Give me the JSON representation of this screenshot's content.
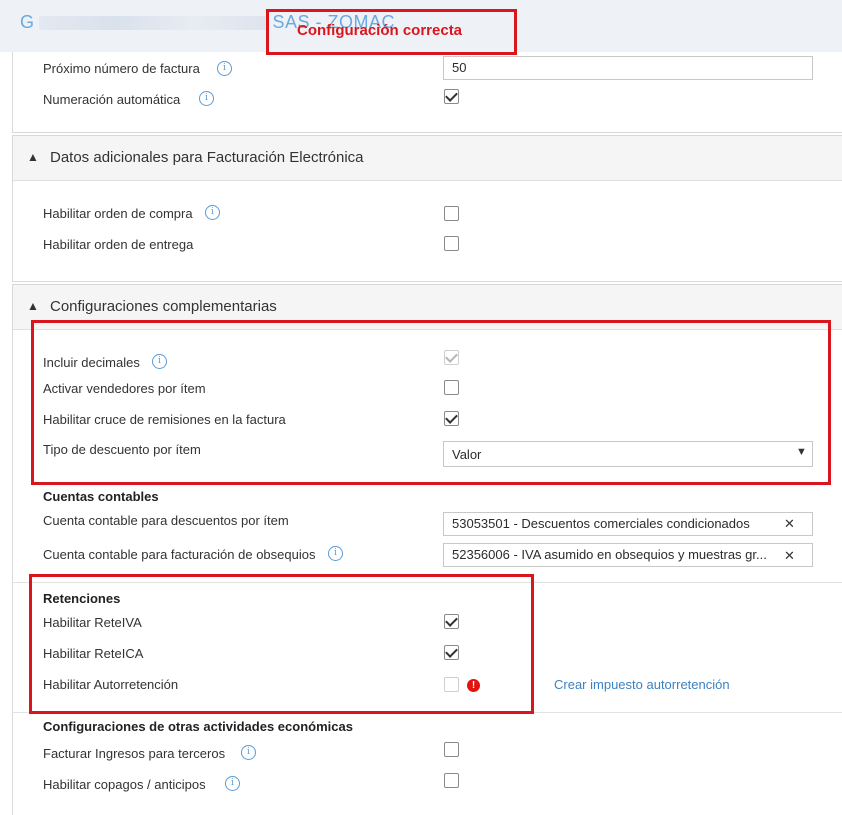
{
  "header": {
    "company_left": "G",
    "company_right": "SAS - ZOMAC"
  },
  "banner": {
    "text": "Configuración correcta"
  },
  "numbering": {
    "next_invoice_label": "Próximo número de factura",
    "next_invoice_value": "50",
    "auto_numbering_label": "Numeración automática",
    "auto_numbering_checked": true
  },
  "e_invoice": {
    "title": "Datos adicionales para Facturación Electrónica",
    "purchase_order_label": "Habilitar orden de compra",
    "delivery_order_label": "Habilitar orden de entrega"
  },
  "complementary": {
    "title": "Configuraciones complementarias",
    "decimals_label": "Incluir decimales",
    "sellers_label": "Activar vendedores por ítem",
    "remissions_label": "Habilitar cruce de remisiones en la factura",
    "discount_type_label": "Tipo de descuento por ítem",
    "discount_type_value": "Valor"
  },
  "accounts": {
    "title": "Cuentas contables",
    "discount_account_label": "Cuenta contable para descuentos por ítem",
    "discount_account_value": "53053501 - Descuentos comerciales condicionados",
    "gift_account_label": "Cuenta contable para facturación de obsequios",
    "gift_account_value": "52356006 - IVA asumido en obsequios y muestras gr..."
  },
  "retentions": {
    "title": "Retenciones",
    "reteiva_label": "Habilitar ReteIVA",
    "reteica_label": "Habilitar ReteICA",
    "autoretention_label": "Habilitar Autorretención",
    "create_tax_link": "Crear impuesto autorretención"
  },
  "other_activities": {
    "title": "Configuraciones de otras actividades económicas",
    "third_party_label": "Facturar Ingresos para terceros",
    "copay_label": "Habilitar copagos / anticipos"
  },
  "icons": {
    "info": "info-icon",
    "check": "checkmark-icon",
    "chevron_up": "chevron-up-icon",
    "chevron_down": "chevron-down-icon",
    "close": "close-icon",
    "warning": "warning-icon"
  },
  "colors": {
    "highlight": "#d9161d",
    "link": "#3b82c4",
    "info": "#5b9bd5"
  }
}
